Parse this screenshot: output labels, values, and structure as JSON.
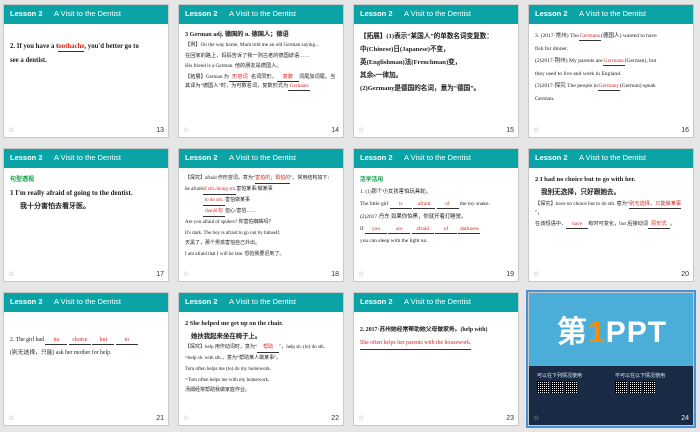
{
  "header": {
    "tag": "Lesson 2",
    "title": "A Visit to the Dentist"
  },
  "star": "☆",
  "slides": {
    "s13": {
      "number": "13",
      "line1_pre": "2. If you have a t",
      "line1_blank": "oothache",
      "line1_post": ", you'd better go to",
      "line2": "see a dentist."
    },
    "s14": {
      "number": "14",
      "heading": "3  German  adj. 德国的    n. 德国人；德语",
      "lines": [
        "【例】On the way home, Mum told me an old German saying...",
        "在回家的路上，妈妈告诉了我一则古老的德国谚语……",
        "His friend is a German. 他的朋友是德国人。"
      ],
      "note_pre": "【拓展】German 为",
      "note_blank1": "形容词",
      "note_mid": "名词同形，",
      "note_blank2": "复数",
      "note_post": "词尾加词尾。当其译为“德国人”时，为可数名词，复数形式为",
      "note_blank3": "Germans"
    },
    "s15": {
      "number": "15",
      "lines": [
        "【拓展】(1)表示“某国人”的单数名词变复数：",
        "中(Chinese)日(Japanese)不变，",
        "英(Englishman)法(Frenchman)变，",
        "其余s一律加。",
        "(2)Germany是德国的名词，意为“德国”。"
      ]
    },
    "s16": {
      "number": "16",
      "l1_pre": "3. (2017·常州) Tho",
      "l1_blank": "Germans",
      "l1_post": "(德国人) wanted to have",
      "l2": "fish for dinner.",
      "l3_pre": "(2)2017·荆州) My parents are",
      "l3_blank": "Germans",
      "l3_post": "(German), but",
      "l4": "they used to live and work in England.",
      "l5_pre": "(3)2017·探究 The people in",
      "l5_blank": "Germany",
      "l5_post": "(German) speak",
      "l6": "German."
    },
    "s17": {
      "number": "17",
      "section": "句型透视",
      "en": "1  I'm really afraid of going to the dentist.",
      "cn": "我十分害怕去看牙医。"
    },
    "s18": {
      "number": "18",
      "lines_pre": "【探究】afraid 作形容词，意为“",
      "blank1": "害怕的；惧怕的",
      "lines_post": "”。常用结构如下：",
      "l2_pre": "be afraid",
      "l2_blank": "of sth./doing sth.",
      "l2_post": "害怕某事/做某事",
      "l3_blank": "to do sth.",
      "l3_post": "害怕做某事",
      "l4_blank": "that从句",
      "l4_post": "担心/害怕……",
      "ex": [
        "Are you afraid of spiders? 你害怕蜘蛛吗？",
        "It's dark. The boy is afraid to go out by himself.",
        "天黑了，那个男孩害怕自己外出。",
        "I am afraid that I will be late. 恐怕我要迟到了。"
      ]
    },
    "s19": {
      "number": "19",
      "section": "活学活用",
      "l1": "1. (1)那个小女孩害怕玩具蛇。",
      "l2_pre": "The little girl",
      "l2_b1": "is",
      "l2_b2": "afraid",
      "l2_b3": "of",
      "l2_post": "the toy snake.",
      "l3": "(2)2017·丹东  如果你怕黑，你就开着灯睡觉。",
      "l4_pre": "If",
      "l4_b1": "you",
      "l4_b2": "are",
      "l4_b3": "afraid",
      "l4_b4": "of",
      "l4_b5": "darkness",
      "l5": "you can sleep with the light on."
    },
    "s20": {
      "number": "20",
      "en": "2  I had no choice but to go with her.",
      "cn": "我别无选择，只好跟她去。",
      "l1_pre": "【探究】have no choice but to do sth. 意为“",
      "l1_blank": "别无选择，只能做某事",
      "l1_post": "”，",
      "l2_pre": "在该短语中，",
      "l2_blank": "have",
      "l2_mid": "有时可变化，but 后接动词",
      "l2_blank2": "原形式",
      "l2_post": "。"
    },
    "s21": {
      "number": "21",
      "l1_pre": "2. The girl had",
      "b1": "no",
      "b2": "choice",
      "b3": "but",
      "b4": "to",
      "l2": "(别无选择，只能) ask her mother for help."
    },
    "s22": {
      "number": "22",
      "en": "2  She helped me get up on the chair.",
      "cn": "她扶我起来坐在椅子上。",
      "l1_pre": "【探究】help 用作动词时，意为“",
      "l1_blank": "帮助",
      "l1_post": "”，help sb. (to) do sth.",
      "l2": "=help sb. with sth.，意为“帮助某人做某事”。",
      "l3": "Tom often helps me (to) do my homework.",
      "l4": "=Tom often helps me with my homework.",
      "l5": "汤姆经常帮助我做家庭作业。"
    },
    "s23": {
      "number": "23",
      "heading": "2. 2017·苏州她经常帮助她父母做家务。(help with)",
      "answer": "She often helps her parents with the housework."
    },
    "s24": {
      "number": "24",
      "logo_pre": "第",
      "logo_one": "1",
      "logo_post": "PPT",
      "left_title": "可以在下列情况使用",
      "right_title": "不可以在以下情况使用"
    }
  }
}
